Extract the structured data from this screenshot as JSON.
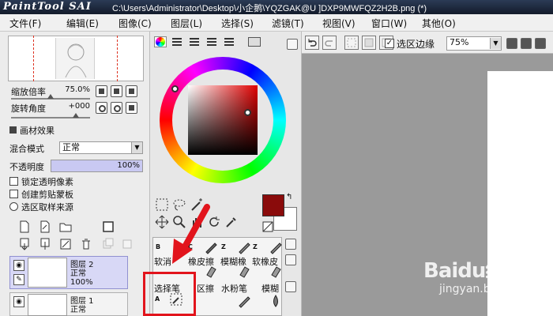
{
  "app": {
    "logo": "PaintTool SAI",
    "title_path": "C:\\Users\\Administrator\\Desktop\\小企鹅\\YQZGAK@U ]DXP9MWFQZ2H2B.png (*)"
  },
  "menu": [
    {
      "label": "文件(F)"
    },
    {
      "label": "编辑(E)"
    },
    {
      "label": "图像(C)"
    },
    {
      "label": "图层(L)"
    },
    {
      "label": "选择(S)"
    },
    {
      "label": "滤镜(T)"
    },
    {
      "label": "视图(V)"
    },
    {
      "label": "窗口(W)"
    },
    {
      "label": "其他(O)"
    }
  ],
  "navigator": {
    "zoom_label": "缩放倍率",
    "zoom_value": "75.0%",
    "rotate_label": "旋转角度",
    "rotate_value": "+000"
  },
  "layer_props": {
    "effect_label": "画材效果",
    "blend_label": "混合模式",
    "blend_value": "正常",
    "opacity_label": "不透明度",
    "opacity_value": "100%",
    "opacity_fraction": 1.0,
    "lock_transparent": "锁定透明像素",
    "clipping_group": "创建剪贴蒙板",
    "selection_source": "选区取样来源"
  },
  "layers": [
    {
      "name": "图层 2",
      "mode": "正常",
      "opacity": "100%"
    },
    {
      "name": "图层 1",
      "mode": "正常",
      "opacity": ""
    }
  ],
  "toolbar": {
    "selection_edge": "选区边缘",
    "zoom_select": "75%"
  },
  "tools": {
    "row1_letters": [
      "B",
      "C",
      "Z",
      "Z"
    ],
    "row2": [
      "软消",
      "橡皮擦",
      "模糊橡",
      "软橡皮"
    ],
    "row3": [
      "选择笔",
      "区擦",
      "水粉笔",
      "模糊"
    ],
    "select_letter": "A"
  },
  "colors": {
    "primary": "#8a0b0b",
    "secondary": "#ffffff",
    "highlight": "#e2141c",
    "title_bar": "#1b2538"
  },
  "watermark": {
    "brand": "Baidu经验",
    "url": "jingyan.baidu.com"
  }
}
